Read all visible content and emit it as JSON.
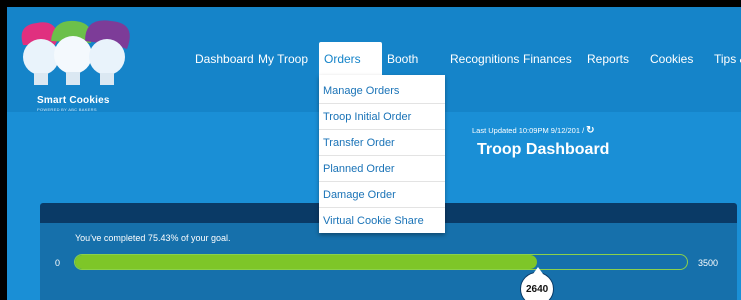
{
  "brand": {
    "name": "Smart Cookies",
    "tagline": "POWERED BY ABC BAKERS",
    "colors": {
      "pink": "#e0307f",
      "green": "#6cc04a",
      "purple": "#7d3c98"
    }
  },
  "nav": {
    "items": [
      {
        "label": "Dashboard"
      },
      {
        "label": "My Troop"
      },
      {
        "label": "Orders"
      },
      {
        "label": "Booth"
      },
      {
        "label": "Recognitions"
      },
      {
        "label": "Finances"
      },
      {
        "label": "Reports"
      },
      {
        "label": "Cookies"
      },
      {
        "label": "Tips &"
      }
    ],
    "active": "Orders"
  },
  "dropdown": {
    "items": [
      {
        "label": "Manage Orders"
      },
      {
        "label": "Troop Initial Order"
      },
      {
        "label": "Transfer Order"
      },
      {
        "label": "Planned Order"
      },
      {
        "label": "Damage Order"
      },
      {
        "label": "Virtual Cookie Share"
      }
    ]
  },
  "header": {
    "last_updated": "Last Updated 10:09PM 9/12/201 /",
    "refresh_icon": "refresh-icon",
    "title": "Troop Dashboard"
  },
  "goal": {
    "message": "You've completed 75.43% of your goal.",
    "min": "0",
    "max": "3500",
    "current": "2640",
    "percent": 75.43,
    "fill_color": "#7ec628"
  }
}
